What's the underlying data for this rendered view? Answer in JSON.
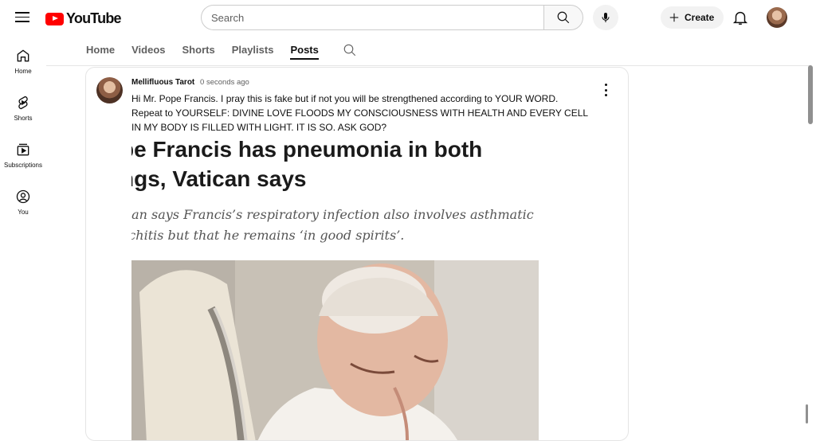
{
  "app": {
    "logo_text": "YouTube",
    "accent": "#ff0000"
  },
  "header": {
    "search_placeholder": "Search",
    "create_label": "Create"
  },
  "sidenav": {
    "items": [
      {
        "label": "Home",
        "icon": "home-icon"
      },
      {
        "label": "Shorts",
        "icon": "shorts-icon"
      },
      {
        "label": "Subscriptions",
        "icon": "subscriptions-icon"
      },
      {
        "label": "You",
        "icon": "you-icon"
      }
    ]
  },
  "tabs": {
    "items": [
      "Home",
      "Videos",
      "Shorts",
      "Playlists",
      "Posts"
    ],
    "active": "Posts"
  },
  "post": {
    "author": "Mellifluous Tarot",
    "time": "0 seconds ago",
    "text_lines": [
      "Hi Mr. Pope Francis. I pray this is fake but if not you will be strengthened according to YOUR WORD.",
      "Repeat to YOURSELF: DIVINE LOVE FLOODS MY CONSCIOUSNESS WITH HEALTH AND EVERY CELL",
      "IN MY BODY IS FILLED WITH LIGHT. IT IS SO. ASK GOD?"
    ],
    "image": {
      "headline_lines": [
        "pe Francis has pneumonia in both",
        "ngs, Vatican says"
      ],
      "subhead_lines": [
        "ican says Francis’s respiratory infection also involves asthmatic",
        "nchitis but that he remains ‘in good spirits’."
      ]
    }
  }
}
